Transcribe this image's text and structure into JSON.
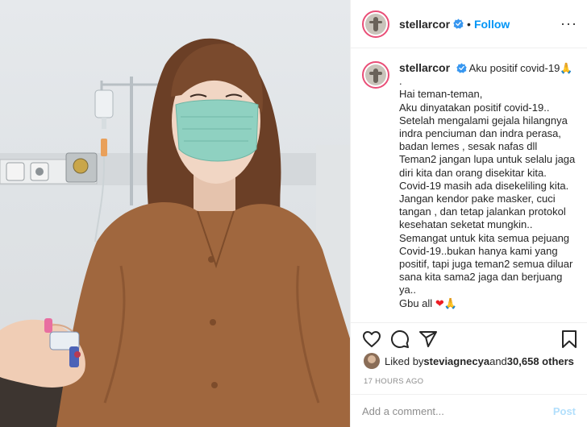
{
  "post": {
    "username": "stellarcor",
    "follow_label": "Follow",
    "separator": "•",
    "more_label": "···",
    "caption_title": "Aku positif covid-19🙏",
    "caption_lines": [
      ".",
      "Hai teman-teman,",
      "Aku dinyatakan positif covid-19..",
      "Setelah mengalami gejala hilangnya",
      "indra penciuman dan indra perasa,",
      "badan lemes , sesak nafas dll",
      "Teman2 jangan lupa untuk selalu jaga",
      "diri kita dan orang disekitar kita.",
      "Covid-19 masih ada disekeliling kita.",
      "Jangan kendor pake masker, cuci",
      "tangan , dan tetap jalankan protokol",
      "kesehatan seketat mungkin..",
      "Semangat untuk kita semua pejuang",
      "Covid-19..bukan hanya kami yang",
      "positif, tapi juga teman2 semua diluar",
      "sana kita sama2 jaga dan berjuang",
      "ya.."
    ],
    "caption_last_text": "Gbu all ",
    "caption_last_heart": "❤",
    "caption_last_pray": "🙏",
    "likes_prefix": "Liked by ",
    "liker_name": "steviagnecya",
    "likes_and": " and ",
    "likes_count": "30,658 others",
    "timestamp": "17 HOURS AGO",
    "comment_placeholder": "Add a comment...",
    "post_button": "Post"
  },
  "icons": {
    "like": "heart-outline-icon",
    "comment": "speech-bubble-icon",
    "share": "paper-plane-icon",
    "save": "bookmark-icon",
    "verified": "verified-badge-icon"
  },
  "colors": {
    "accent": "#0095f6",
    "verified": "#3897f0",
    "story_ring": "#e94e77",
    "muted": "#8e8e8e"
  }
}
